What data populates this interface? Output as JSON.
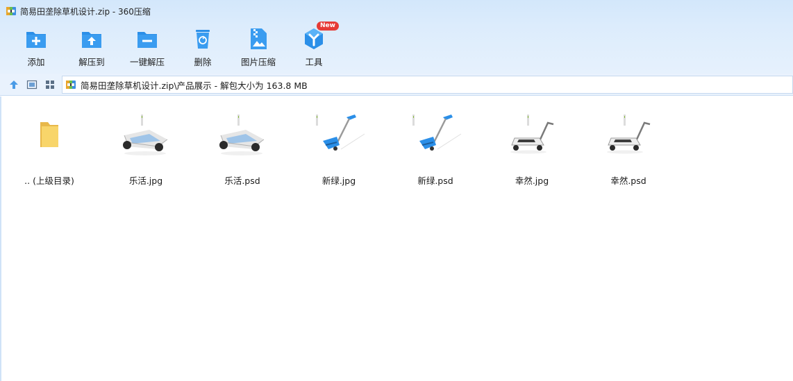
{
  "window": {
    "title": "简易田垄除草机设计.zip - 360压缩",
    "icon": "archive-icon"
  },
  "toolbar": {
    "items": [
      {
        "label": "添加",
        "icon": "add-folder-icon"
      },
      {
        "label": "解压到",
        "icon": "extract-to-icon"
      },
      {
        "label": "一键解压",
        "icon": "quick-extract-icon"
      },
      {
        "label": "删除",
        "icon": "recycle-bin-icon"
      },
      {
        "label": "图片压缩",
        "icon": "image-compress-icon"
      },
      {
        "label": "工具",
        "icon": "tools-cube-icon",
        "badge": "New"
      }
    ]
  },
  "navbar": {
    "path": "简易田垄除草机设计.zip\\产品展示 - 解包大小为 163.8 MB",
    "buttons": [
      "up-arrow-icon",
      "detail-view-icon",
      "thumbnail-view-icon"
    ]
  },
  "files": [
    {
      "name": ".. (上级目录)",
      "kind": "folder"
    },
    {
      "name": "乐活.jpg",
      "kind": "image",
      "product": "triangle-robot"
    },
    {
      "name": "乐活.psd",
      "kind": "image",
      "product": "triangle-robot"
    },
    {
      "name": "新绿.jpg",
      "kind": "image",
      "product": "handle-trimmer"
    },
    {
      "name": "新绿.psd",
      "kind": "image",
      "product": "handle-trimmer"
    },
    {
      "name": "幸然.jpg",
      "kind": "image",
      "product": "push-mower"
    },
    {
      "name": "幸然.psd",
      "kind": "image",
      "product": "push-mower"
    }
  ],
  "colors": {
    "accent": "#2b8fe8",
    "badge": "#e63b36",
    "folder": "#f5cf5c"
  }
}
